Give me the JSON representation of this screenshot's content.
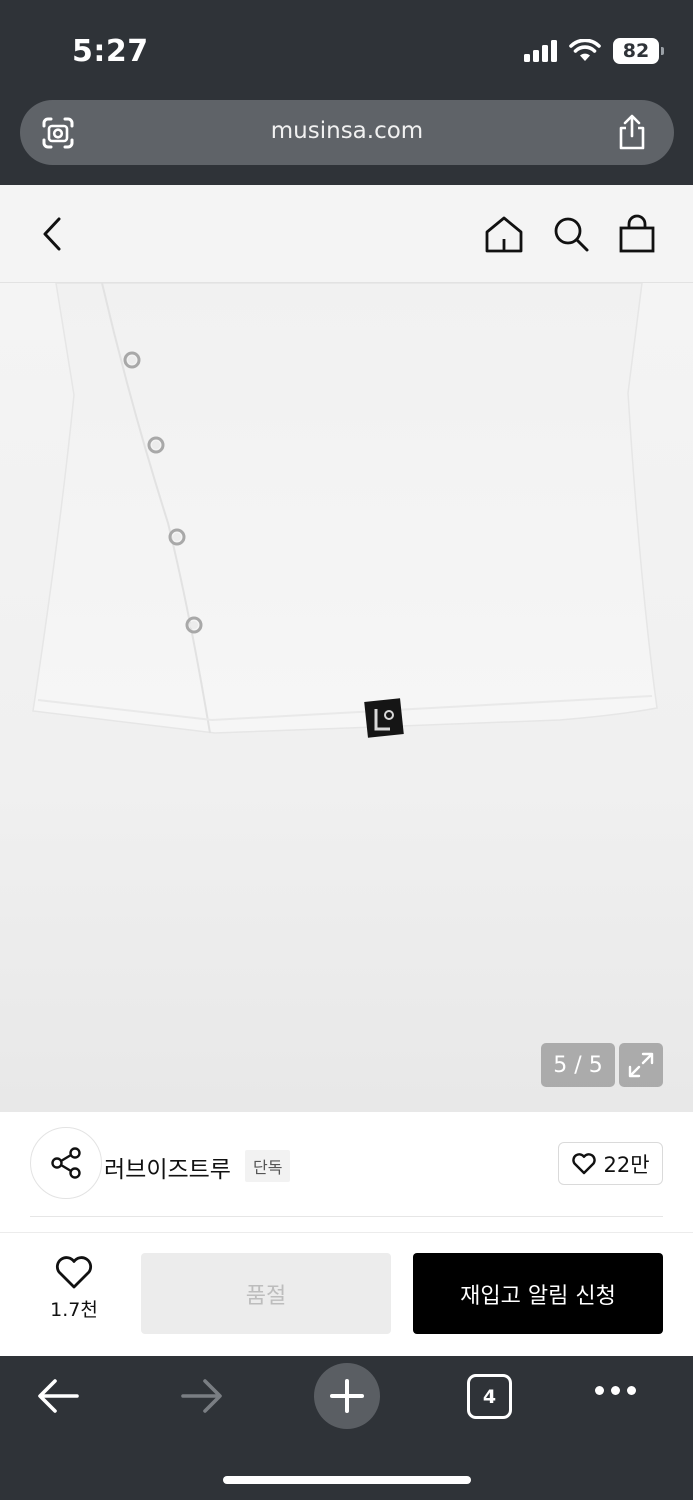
{
  "status_bar": {
    "time": "5:27",
    "battery": "82"
  },
  "browser": {
    "url": "musinsa.com",
    "tab_count": "4"
  },
  "header": {
    "icons": [
      "back-icon",
      "home-icon",
      "search-icon",
      "shopping-bag-icon"
    ]
  },
  "gallery": {
    "counter": "5 / 5",
    "image_description_icon": "expand-icon"
  },
  "brand": {
    "name": "러브이즈트루",
    "badge": "단독",
    "likes": "22만"
  },
  "purchase": {
    "wish_count": "1.7천",
    "soldout_label": "품절",
    "restock_label": "재입고 알림 신청"
  },
  "colors": {
    "chrome_bg": "#2f3338",
    "url_bar_bg": "#5f6368",
    "header_bg": "#f4f4f4",
    "primary_button": "#000000",
    "disabled_button": "#ececec"
  }
}
